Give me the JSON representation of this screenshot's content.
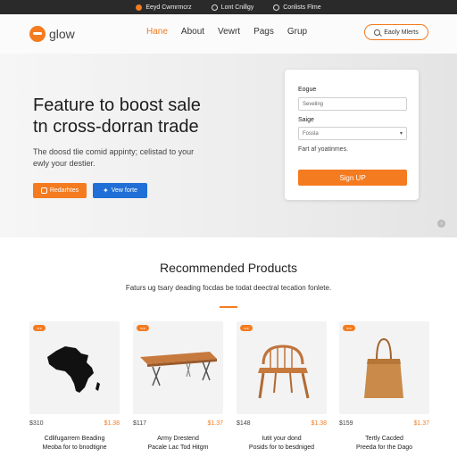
{
  "topbar": {
    "items": [
      "Eeyd Cwmrmcrz",
      "Lont Cnillgy",
      "Conlists Flme"
    ]
  },
  "header": {
    "logo": "glow",
    "nav": [
      "Hane",
      "About",
      "Vewrt",
      "Pags",
      "Grup"
    ],
    "active_index": 0,
    "pill_button": "Eaoly Mlerts"
  },
  "hero": {
    "title_line1": "Feature to boost sale",
    "title_line2": "tn cross-dorran trade",
    "subtitle_line1": "The doosd tlie comid appinty; celistad to your",
    "subtitle_line2": "ewly your destier.",
    "btn_orange": "Redarhtes",
    "btn_blue": "Vew forte"
  },
  "form": {
    "label1": "Eogue",
    "field1_value": "Seveling",
    "label2": "Saige",
    "field2_value": "Fossla",
    "note": "Fart af yoatinmes.",
    "signup": "Sign UP"
  },
  "products_section": {
    "title": "Recommended Products",
    "subtitle": "Faturs ug tsary deading focdas be todat deectral tecation fonlete."
  },
  "products": [
    {
      "badge": "a.s",
      "old_price": "$310",
      "new_price": "$1.38",
      "name_line1": "Cdlifugarrem Beading",
      "name_line2": "Meoba for to bnodtigne",
      "icon": "africa-map-icon"
    },
    {
      "badge": "a.s",
      "old_price": "$117",
      "new_price": "$1.37",
      "name_line1": "Army Drestend",
      "name_line2": "Pacale Lac Tod Hitgm",
      "icon": "wooden-table-icon"
    },
    {
      "badge": "a.s",
      "old_price": "$148",
      "new_price": "$1.38",
      "name_line1": "Iutit your dond",
      "name_line2": "Posids for to besdniged",
      "icon": "wooden-chair-icon"
    },
    {
      "badge": "a.s",
      "old_price": "$159",
      "new_price": "$1.37",
      "name_line1": "Tertly Cacded",
      "name_line2": "Preeda for the Dago",
      "icon": "tote-bag-icon"
    }
  ],
  "colors": {
    "accent": "#f47b20",
    "blue": "#1f6fd6",
    "topbar": "#2a2a2a"
  }
}
